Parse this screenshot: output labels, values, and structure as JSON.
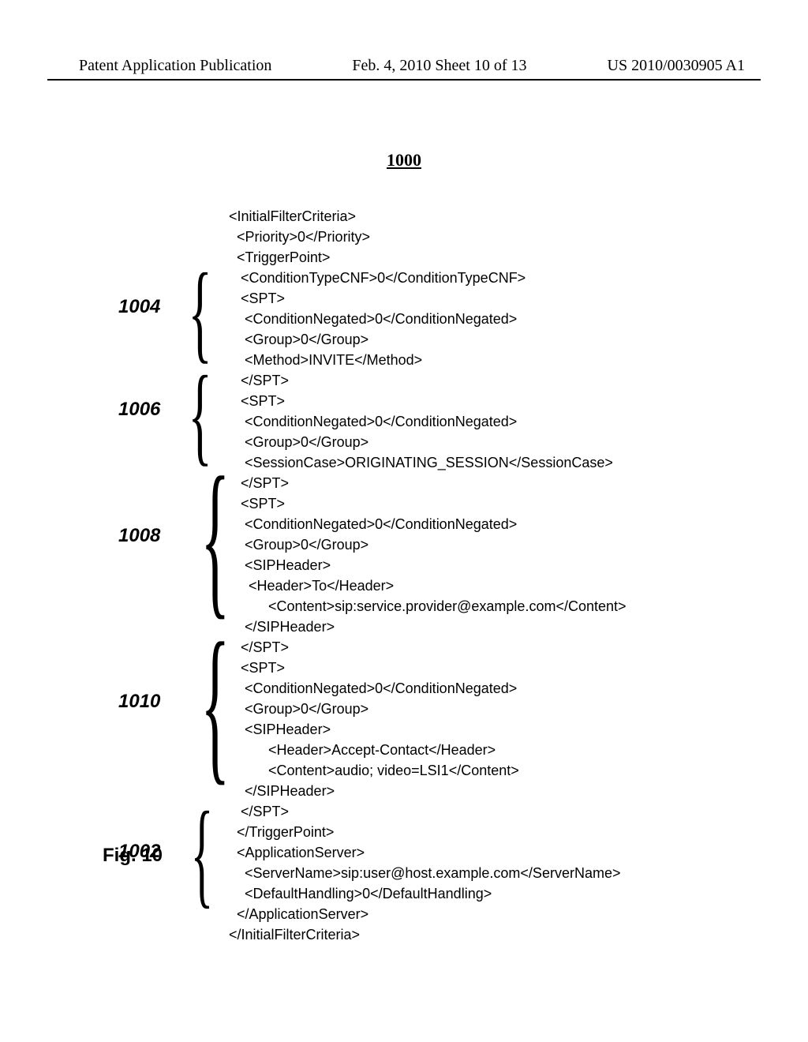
{
  "header": {
    "left": "Patent Application Publication",
    "mid": "Feb. 4, 2010  Sheet 10 of 13",
    "right": "US 2010/0030905 A1"
  },
  "figure_number": "1000",
  "figure_caption": "Fig. 10",
  "refs": {
    "r1004": "1004",
    "r1006": "1006",
    "r1008": "1008",
    "r1010": "1010",
    "r1002": "1002"
  },
  "xml": {
    "l01": "<InitialFilterCriteria>",
    "l02": "  <Priority>0</Priority>",
    "l03": "  <TriggerPoint>",
    "l04": "   <ConditionTypeCNF>0</ConditionTypeCNF>",
    "l05": "   <SPT>",
    "l06": "    <ConditionNegated>0</ConditionNegated>",
    "l07": "    <Group>0</Group>",
    "l08": "    <Method>INVITE</Method>",
    "l09": "   </SPT>",
    "l10": "   <SPT>",
    "l11": "    <ConditionNegated>0</ConditionNegated>",
    "l12": "    <Group>0</Group>",
    "l13": "    <SessionCase>ORIGINATING_SESSION</SessionCase>",
    "l14": "   </SPT>",
    "l15": "   <SPT>",
    "l16": "    <ConditionNegated>0</ConditionNegated>",
    "l17": "    <Group>0</Group>",
    "l18": "    <SIPHeader>",
    "l19": "     <Header>To</Header>",
    "l20": "          <Content>sip:service.provider@example.com</Content>",
    "l21": "    </SIPHeader>",
    "l22": "   </SPT>",
    "l23": "   <SPT>",
    "l24": "    <ConditionNegated>0</ConditionNegated>",
    "l25": "    <Group>0</Group>",
    "l26": "    <SIPHeader>",
    "l27": "          <Header>Accept-Contact</Header>",
    "l28": "          <Content>audio; video=LSI1</Content>",
    "l29": "    </SIPHeader>",
    "l30": "   </SPT>",
    "l31": "  </TriggerPoint>",
    "l32": "  <ApplicationServer>",
    "l33": "    <ServerName>sip:user@host.example.com</ServerName>",
    "l34": "    <DefaultHandling>0</DefaultHandling>",
    "l35": "  </ApplicationServer>",
    "l36": "</InitialFilterCriteria>"
  }
}
